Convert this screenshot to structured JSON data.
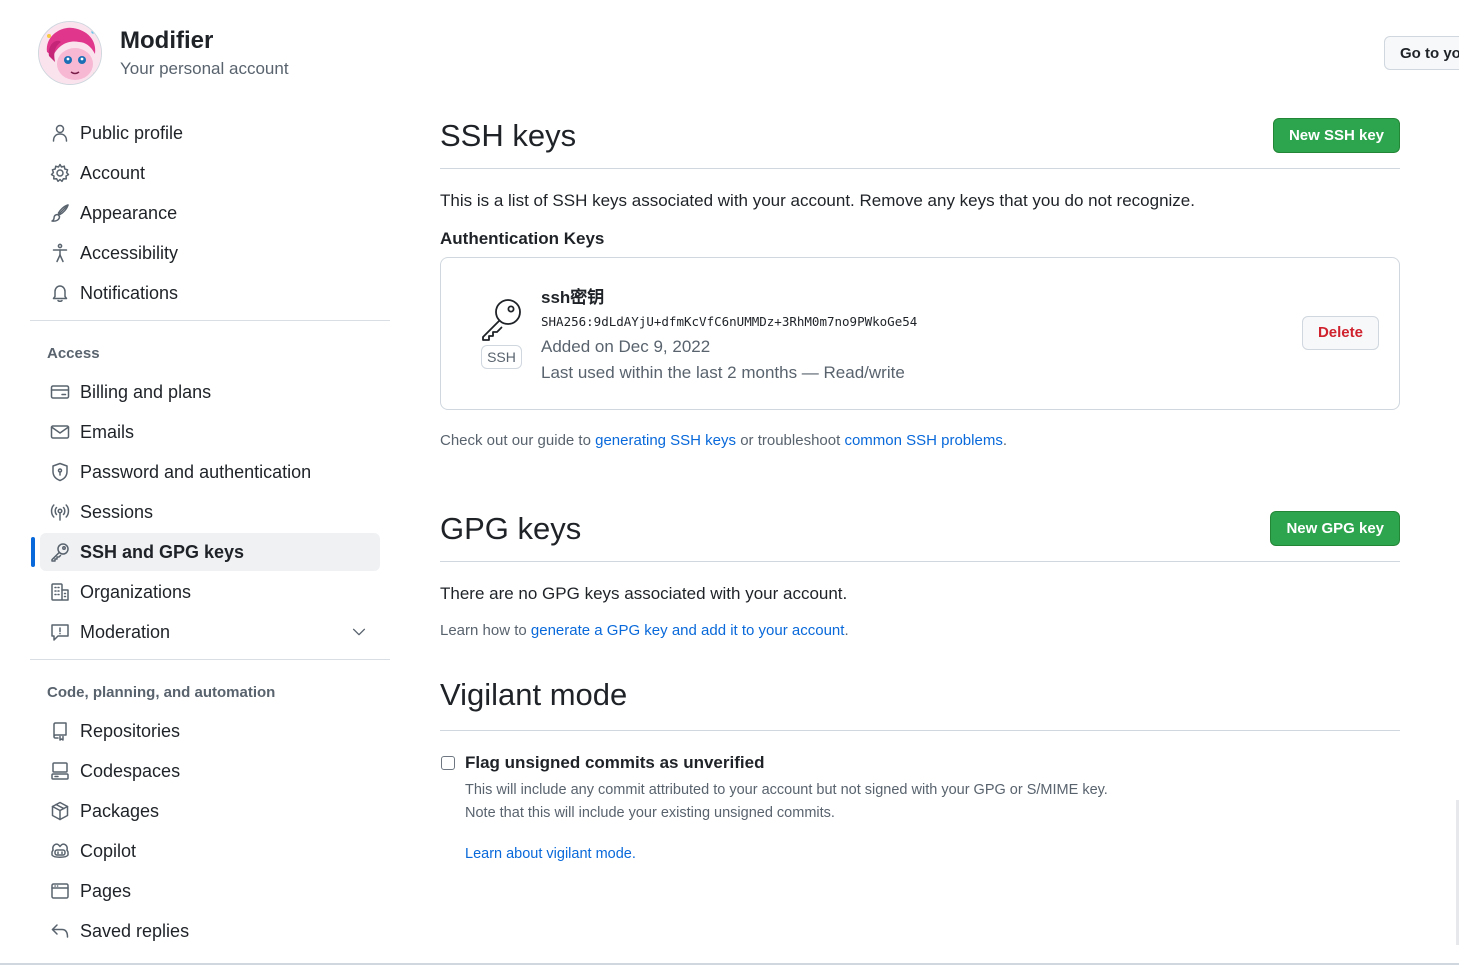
{
  "header": {
    "user_name": "Modifier",
    "user_subtitle": "Your personal account",
    "goto_button": "Go to yo"
  },
  "sidebar": {
    "top_items": [
      {
        "label": "Public profile",
        "icon": "person-icon"
      },
      {
        "label": "Account",
        "icon": "gear-icon"
      },
      {
        "label": "Appearance",
        "icon": "paintbrush-icon"
      },
      {
        "label": "Accessibility",
        "icon": "accessibility-icon"
      },
      {
        "label": "Notifications",
        "icon": "bell-icon"
      }
    ],
    "access_title": "Access",
    "access_items": [
      {
        "label": "Billing and plans",
        "icon": "credit-card-icon"
      },
      {
        "label": "Emails",
        "icon": "mail-icon"
      },
      {
        "label": "Password and authentication",
        "icon": "shield-lock-icon"
      },
      {
        "label": "Sessions",
        "icon": "broadcast-icon"
      },
      {
        "label": "SSH and GPG keys",
        "icon": "key-icon",
        "active": true
      },
      {
        "label": "Organizations",
        "icon": "organization-icon"
      },
      {
        "label": "Moderation",
        "icon": "report-icon"
      }
    ],
    "code_title": "Code, planning, and automation",
    "code_items": [
      {
        "label": "Repositories",
        "icon": "repo-icon"
      },
      {
        "label": "Codespaces",
        "icon": "codespaces-icon"
      },
      {
        "label": "Packages",
        "icon": "package-icon"
      },
      {
        "label": "Copilot",
        "icon": "copilot-icon"
      },
      {
        "label": "Pages",
        "icon": "browser-icon"
      },
      {
        "label": "Saved replies",
        "icon": "reply-icon"
      }
    ]
  },
  "ssh": {
    "title": "SSH keys",
    "new_button": "New SSH key",
    "description": "This is a list of SSH keys associated with your account. Remove any keys that you do not recognize.",
    "auth_heading": "Authentication Keys",
    "key": {
      "badge": "SSH",
      "name": "ssh密钥",
      "fingerprint": "SHA256:9dLdAYjU+dfmKcVfC6nUMMDz+3RhM0m7no9PWkoGe54",
      "added": "Added on Dec 9, 2022",
      "last_used": "Last used within the last 2 months — Read/write",
      "delete_button": "Delete"
    },
    "guide": {
      "prefix": "Check out our guide to ",
      "link1": "generating SSH keys",
      "middle": " or troubleshoot ",
      "link2": "common SSH problems",
      "suffix": "."
    }
  },
  "gpg": {
    "title": "GPG keys",
    "new_button": "New GPG key",
    "empty_text": "There are no GPG keys associated with your account.",
    "learn_prefix": "Learn how to ",
    "learn_link": "generate a GPG key and add it to your account",
    "learn_suffix": "."
  },
  "vigilant": {
    "title": "Vigilant mode",
    "checkbox_label": "Flag unsigned commits as unverified",
    "checked": false,
    "desc_line1": "This will include any commit attributed to your account but not signed with your GPG or S/MIME key.",
    "desc_line2": "Note that this will include your existing unsigned commits.",
    "learn_link": "Learn about vigilant mode."
  },
  "colors": {
    "accent": "#0969da",
    "green_button": "#2da44e",
    "danger": "#cf222e",
    "border": "#d0d7de",
    "muted_text": "#59636e"
  }
}
